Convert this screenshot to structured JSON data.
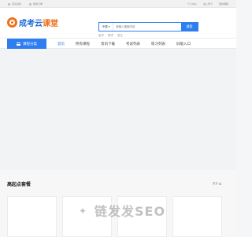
{
  "topbar": {
    "left": [
      "完善资料",
      "我的订单"
    ],
    "right": [
      "个人中心",
      "进入学习",
      "我的课程"
    ]
  },
  "logo": {
    "text_part1": "成考云",
    "text_part2": "课堂"
  },
  "search": {
    "select_label": "专题",
    "placeholder": "请输入搜索内容",
    "button_label": "搜索"
  },
  "hot_keywords": [
    "医学",
    "数学",
    "语文"
  ],
  "nav": {
    "category_label": "课程分类",
    "items": [
      "首页",
      "所有课程",
      "资讯下载",
      "考试列表",
      "练习列表",
      "旧版入口"
    ]
  },
  "section": {
    "title": "高起点套餐",
    "more": "更多"
  },
  "watermark": "链发发SEO"
}
